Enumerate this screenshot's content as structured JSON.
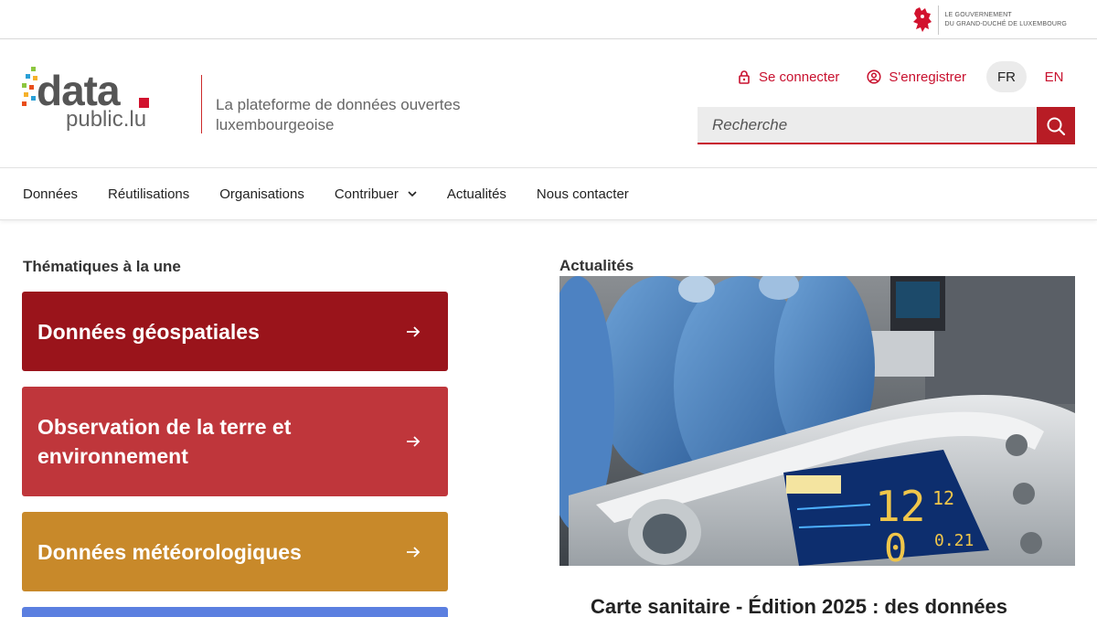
{
  "gov": {
    "line1": "LE GOUVERNEMENT",
    "line2": "DU GRAND-DUCHÉ DE LUXEMBOURG"
  },
  "logo": {
    "word": "data",
    "sub": "public.lu"
  },
  "tagline": "La plateforme de données ouvertes luxembourgeoise",
  "toplinks": {
    "login": "Se connecter",
    "register": "S'enregistrer"
  },
  "languages": [
    "FR",
    "EN"
  ],
  "search": {
    "placeholder": "Recherche"
  },
  "nav": [
    "Données",
    "Réutilisations",
    "Organisations",
    "Contribuer",
    "Actualités",
    "Nous contacter"
  ],
  "themes": {
    "title": "Thématiques à la une",
    "items": [
      {
        "label": "Données géospatiales",
        "color": "#9a141b"
      },
      {
        "label": "Observation de la terre et environnement",
        "color": "#bf363b"
      },
      {
        "label": "Données météorologiques",
        "color": "#c8892a"
      },
      {
        "label": "",
        "color": "#5b7fe0"
      }
    ]
  },
  "news": {
    "title": "Actualités",
    "headline": "Carte sanitaire - Édition 2025 : des données"
  },
  "colors": {
    "accent": "#c8102e",
    "search_button": "#b81c25"
  }
}
